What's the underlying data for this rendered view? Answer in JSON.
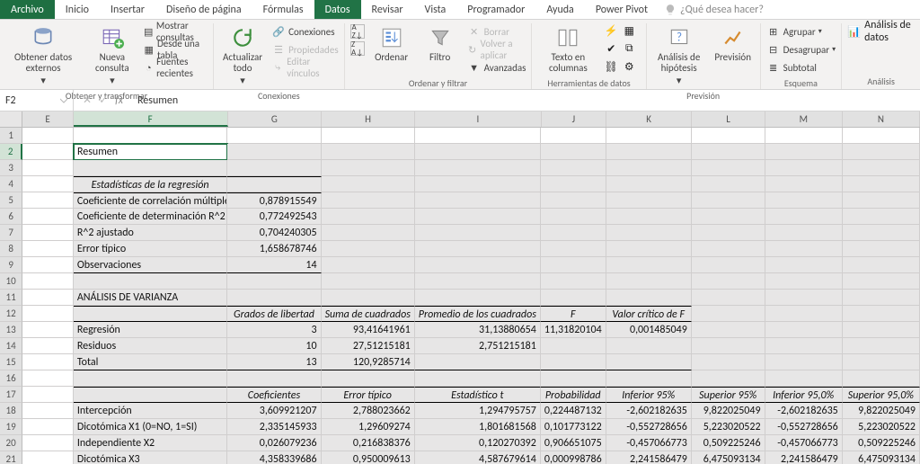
{
  "tabs": {
    "file": "Archivo",
    "list": [
      "Inicio",
      "Insertar",
      "Diseño de página",
      "Fórmulas",
      "Datos",
      "Revisar",
      "Vista",
      "Programador",
      "Ayuda",
      "Power Pivot"
    ],
    "active": "Datos",
    "tell_me": "¿Qué desea hacer?"
  },
  "ribbon": {
    "get_transform": {
      "get_data": "Obtener datos externos",
      "new_query": "Nueva consulta",
      "show_queries": "Mostrar consultas",
      "from_table": "Desde una tabla",
      "recent": "Fuentes recientes",
      "label": "Obtener y transformar"
    },
    "connections": {
      "refresh": "Actualizar todo",
      "connections": "Conexiones",
      "properties": "Propiedades",
      "edit_links": "Editar vínculos",
      "label": "Conexiones"
    },
    "sort": {
      "sort": "Ordenar",
      "filter": "Filtro",
      "clear": "Borrar",
      "reapply": "Volver a aplicar",
      "advanced": "Avanzadas",
      "label": "Ordenar y filtrar"
    },
    "data_tools": {
      "text_cols": "Texto en columnas",
      "label": "Herramientas de datos"
    },
    "forecast": {
      "whatif": "Análisis de hipótesis",
      "forecast": "Previsión",
      "label": "Previsión"
    },
    "outline": {
      "group": "Agrupar",
      "ungroup": "Desagrupar",
      "subtotal": "Subtotal",
      "label": "Esquema"
    },
    "analysis": {
      "data_analysis": "Análisis de datos",
      "label": "Análisis"
    }
  },
  "formula_bar": {
    "cell_ref": "F2",
    "value": "Resumen"
  },
  "columns": [
    "E",
    "F",
    "G",
    "H",
    "I",
    "J",
    "K",
    "L",
    "M",
    "N"
  ],
  "chart_data": {
    "type": "table",
    "title": "Resumen",
    "regression_stats": {
      "heading": "Estadísticas de la regresión",
      "rows": [
        {
          "label": "Coeficiente de correlación múltiple",
          "value": "0,878915549"
        },
        {
          "label": "Coeficiente de determinación R^2",
          "value": "0,772492543"
        },
        {
          "label": "R^2  ajustado",
          "value": "0,704240305"
        },
        {
          "label": "Error típico",
          "value": "1,658678746"
        },
        {
          "label": "Observaciones",
          "value": "14"
        }
      ]
    },
    "anova": {
      "heading": "ANÁLISIS DE VARIANZA",
      "columns": [
        "",
        "Grados de libertad",
        "Suma de cuadrados",
        "Promedio de los cuadrados",
        "F",
        "Valor crítico de F"
      ],
      "rows": [
        {
          "label": "Regresión",
          "df": "3",
          "ss": "93,41641961",
          "ms": "31,13880654",
          "f": "11,31820104",
          "sigf": "0,001485049"
        },
        {
          "label": "Residuos",
          "df": "10",
          "ss": "27,51215181",
          "ms": "2,751215181",
          "f": "",
          "sigf": ""
        },
        {
          "label": "Total",
          "df": "13",
          "ss": "120,9285714",
          "ms": "",
          "f": "",
          "sigf": ""
        }
      ]
    },
    "coef": {
      "columns": [
        "",
        "Coeficientes",
        "Error típico",
        "Estadístico t",
        "Probabilidad",
        "Inferior 95%",
        "Superior 95%",
        "Inferior 95,0%",
        "Superior 95,0%"
      ],
      "rows": [
        {
          "label": "Intercepción",
          "c": "3,609921207",
          "se": "2,788023662",
          "t": "1,294795757",
          "p": "0,224487132",
          "lo": "-2,602182635",
          "hi": "9,822025049",
          "lo2": "-2,602182635",
          "hi2": "9,822025049"
        },
        {
          "label": "Dicotómica X1 (0=NO, 1=SI)",
          "c": "2,335145933",
          "se": "1,29609274",
          "t": "1,801681568",
          "p": "0,101773122",
          "lo": "-0,552728656",
          "hi": "5,223020522",
          "lo2": "-0,552728656",
          "hi2": "5,223020522"
        },
        {
          "label": "Independiente X2",
          "c": "0,026079236",
          "se": "0,216838376",
          "t": "0,120270392",
          "p": "0,906651075",
          "lo": "-0,457066773",
          "hi": "0,509225246",
          "lo2": "-0,457066773",
          "hi2": "0,509225246"
        },
        {
          "label": "Dicotómica X3",
          "c": "4,358339686",
          "se": "0,950009613",
          "t": "4,587679614",
          "p": "0,000998786",
          "lo": "2,241586479",
          "hi": "6,475093134",
          "lo2": "2,241586479",
          "hi2": "6,475093134"
        }
      ]
    }
  }
}
